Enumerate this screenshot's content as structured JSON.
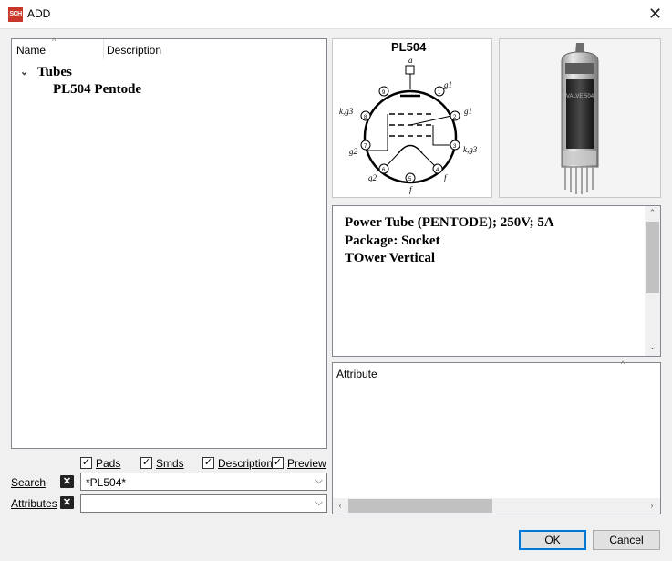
{
  "window": {
    "title": "ADD",
    "icon_text": "SCH",
    "close_glyph": "✕"
  },
  "tree": {
    "columns": [
      "Name",
      "Description"
    ],
    "items": [
      {
        "label": "Tubes",
        "expanded": true
      },
      {
        "label": "PL504 Pentode"
      }
    ]
  },
  "options": {
    "pads": {
      "label": "Pads",
      "checked": true
    },
    "smds": {
      "label": "Smds",
      "checked": true
    },
    "description": {
      "label": "Description",
      "checked": true
    },
    "preview": {
      "label": "Preview",
      "checked": true
    }
  },
  "search": {
    "label": "Search",
    "value": "*PL504*"
  },
  "attributes": {
    "label": "Attributes",
    "value": ""
  },
  "schematic": {
    "title": "PL504",
    "pins": {
      "a": "a",
      "g1_top": "g1",
      "g1_right": "g1",
      "kg3_left": "k,g3",
      "kg3_right": "k,g3",
      "g2_left": "g2",
      "g2_bottom": "g2",
      "f_bottom": "f",
      "f_right": "f"
    },
    "pin_numbers": [
      "1",
      "2",
      "3",
      "4",
      "5",
      "6",
      "7",
      "8",
      "9"
    ]
  },
  "tube_photo": {
    "label": "VALVE 504"
  },
  "description": {
    "lines": [
      "Power Tube (PENTODE); 250V; 5A",
      "Package: Socket",
      "TOwer Vertical"
    ]
  },
  "attribute_panel": {
    "header": "Attribute"
  },
  "buttons": {
    "ok": "OK",
    "cancel": "Cancel"
  },
  "colors": {
    "accent": "#0078d7",
    "icon_red": "#c8362c"
  }
}
